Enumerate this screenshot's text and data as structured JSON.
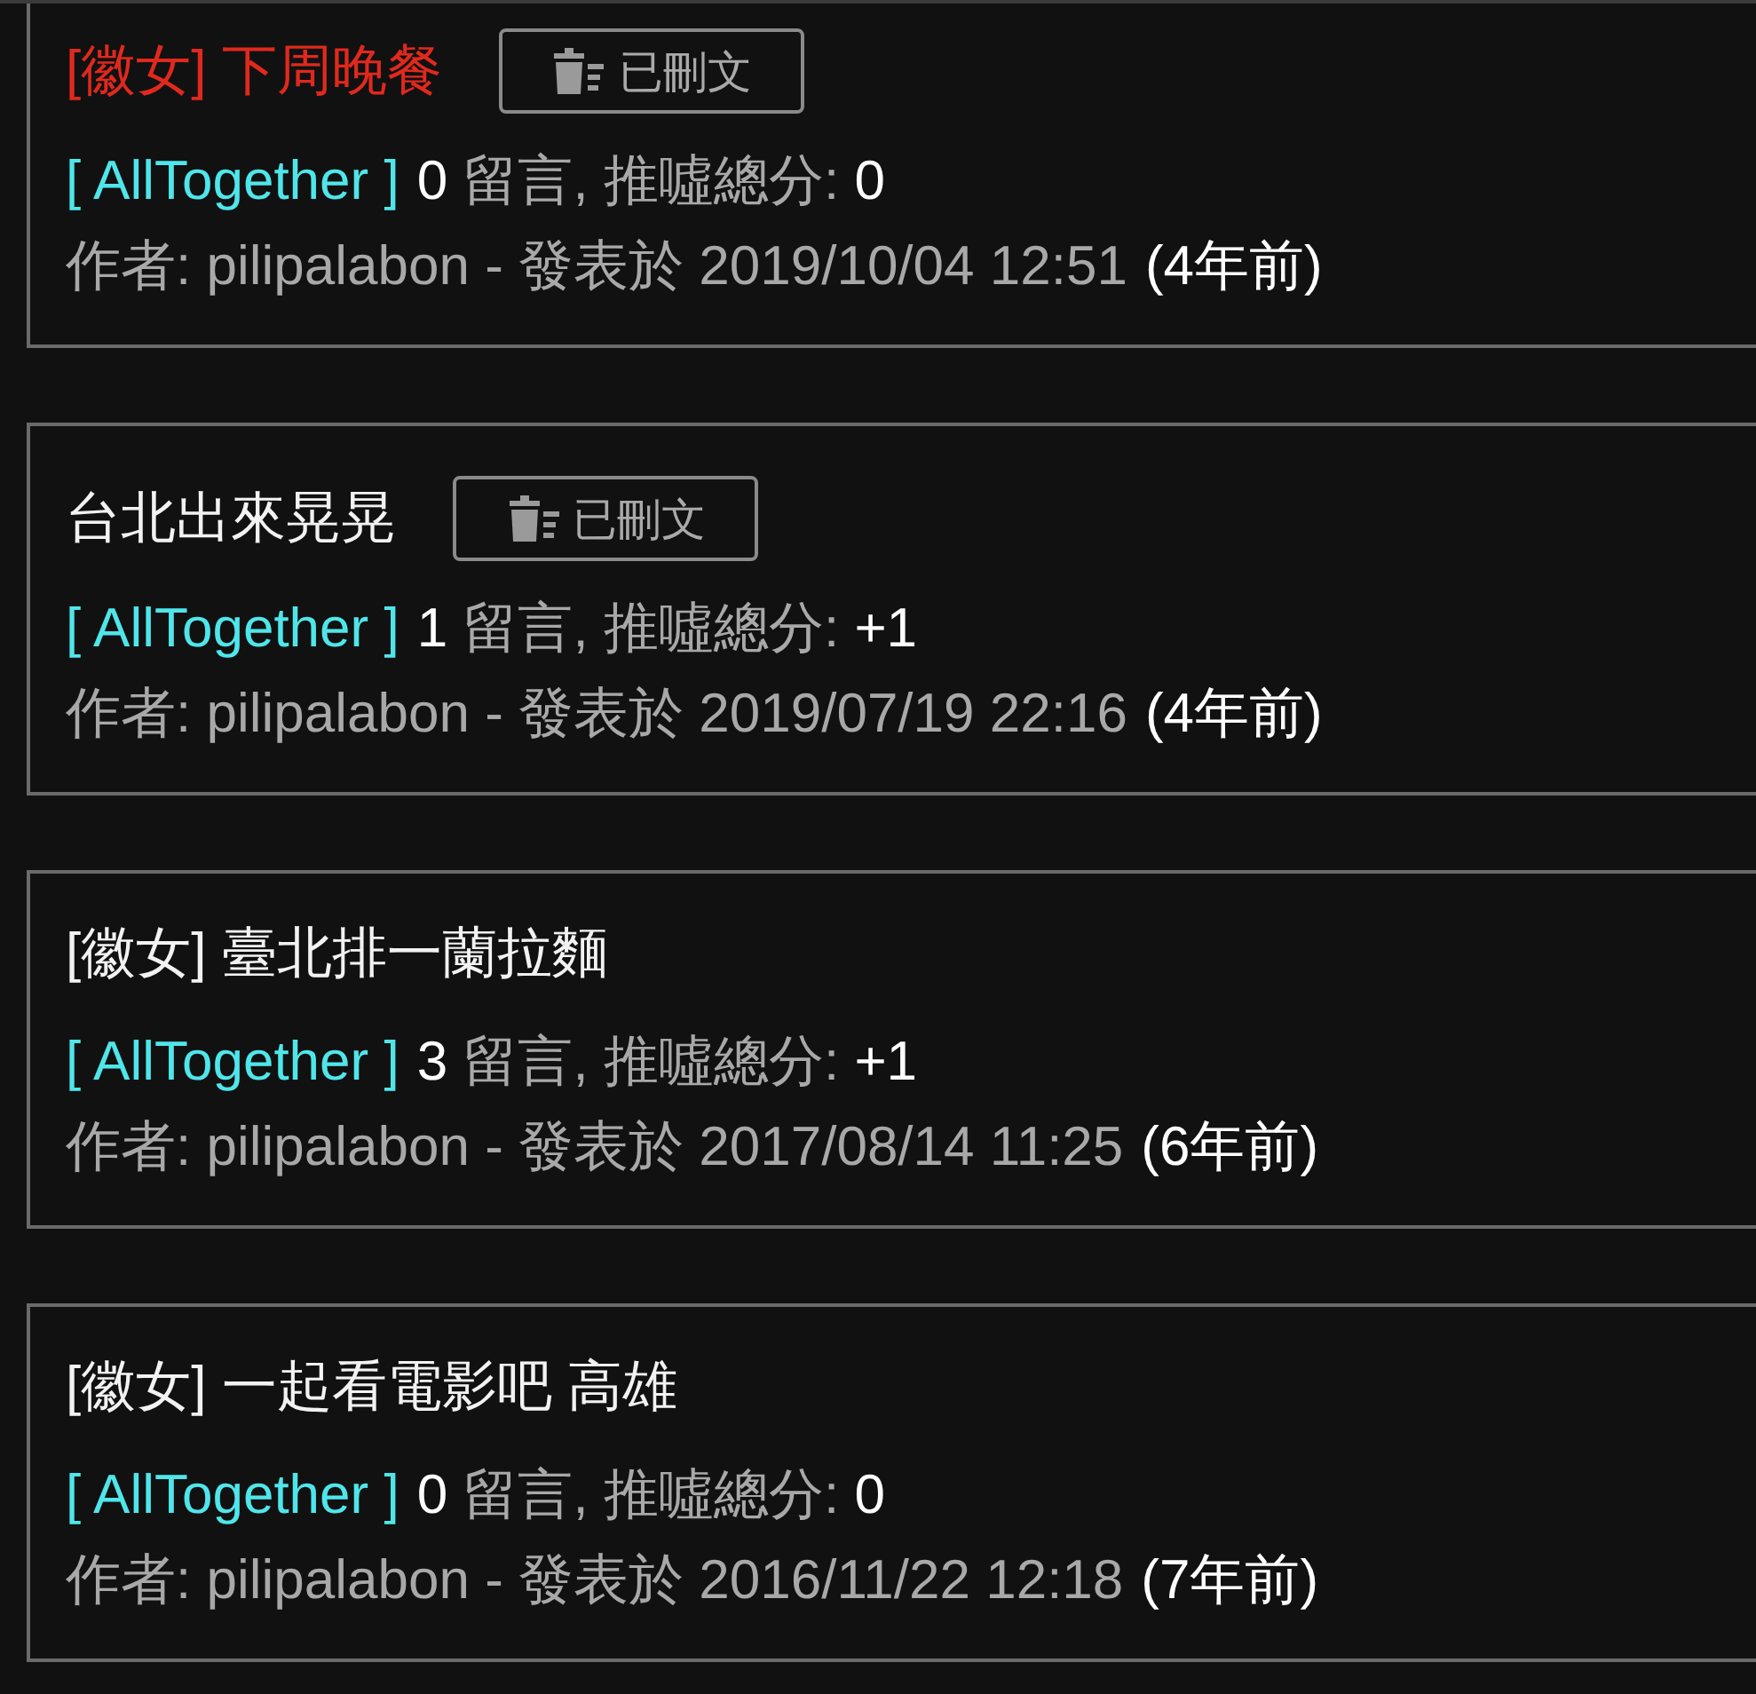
{
  "posts": [
    {
      "title": "[徽女] 下周晚餐",
      "highlighted": true,
      "deleted": true,
      "deleted_label": "已刪文",
      "board": "[ AllTogether ]",
      "comments": "0",
      "comments_label": "留言, 推噓總分:",
      "score": "0",
      "byline": "作者: pilipalabon - 發表於 2019/10/04 12:51",
      "age": "(4年前)"
    },
    {
      "title": "台北出來晃晃",
      "highlighted": false,
      "deleted": true,
      "deleted_label": "已刪文",
      "board": "[ AllTogether ]",
      "comments": "1",
      "comments_label": "留言, 推噓總分:",
      "score": "+1",
      "byline": "作者: pilipalabon - 發表於 2019/07/19 22:16",
      "age": "(4年前)"
    },
    {
      "title": "[徽女] 臺北排一蘭拉麵",
      "highlighted": false,
      "deleted": false,
      "board": "[ AllTogether ]",
      "comments": "3",
      "comments_label": "留言, 推噓總分:",
      "score": "+1",
      "byline": "作者: pilipalabon - 發表於 2017/08/14 11:25",
      "age": "(6年前)"
    },
    {
      "title": "[徽女] 一起看電影吧 高雄",
      "highlighted": false,
      "deleted": false,
      "board": "[ AllTogether ]",
      "comments": "0",
      "comments_label": "留言, 推噓總分:",
      "score": "0",
      "byline": "作者: pilipalabon - 發表於 2016/11/22 12:18",
      "age": "(7年前)"
    }
  ]
}
